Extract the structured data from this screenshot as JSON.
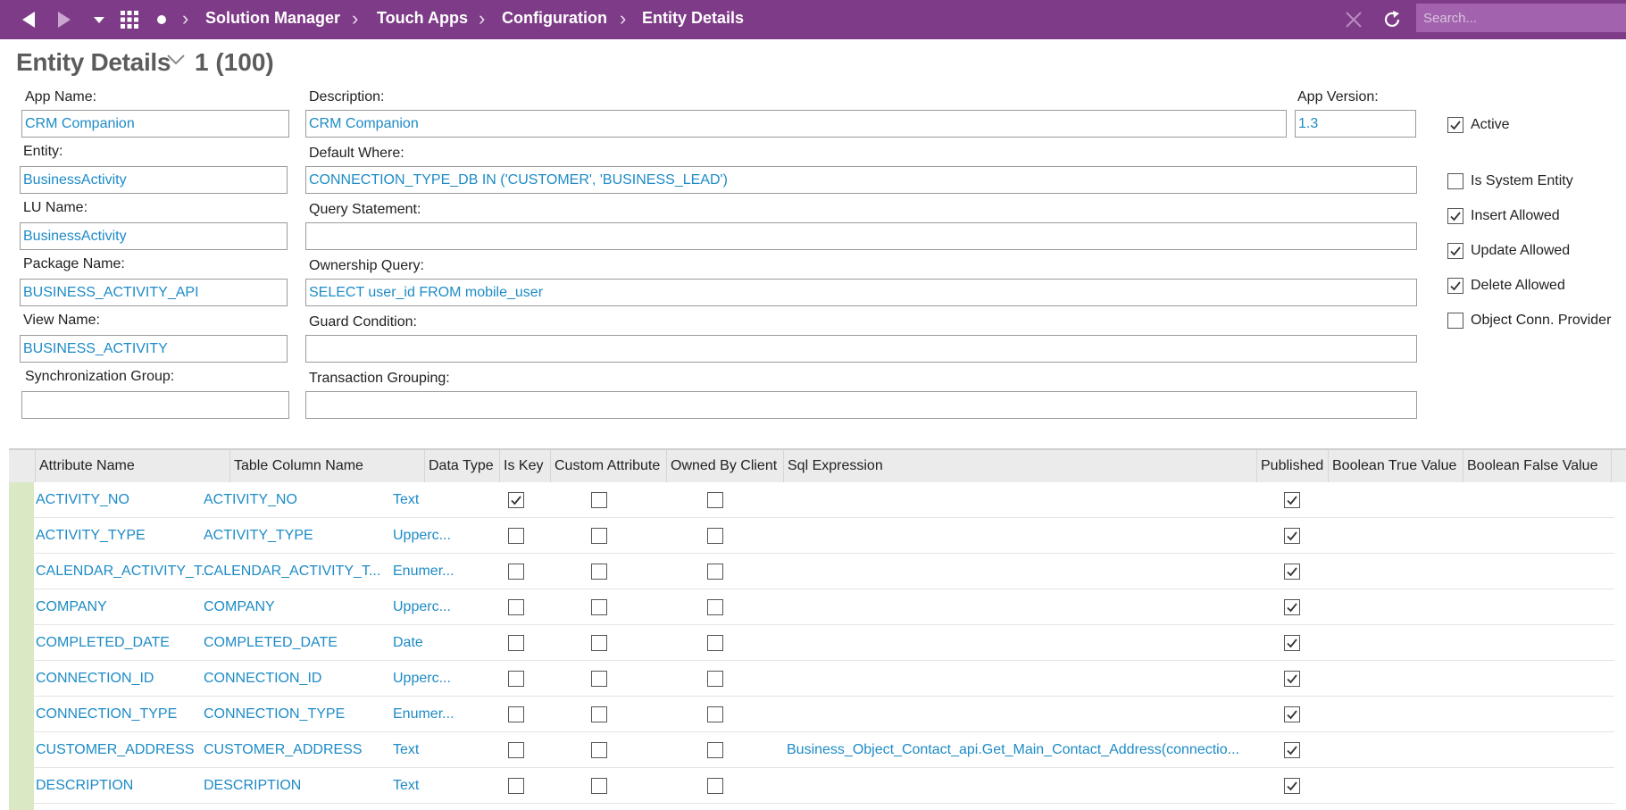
{
  "breadcrumb": [
    "Solution Manager",
    "Touch Apps",
    "Configuration",
    "Entity Details"
  ],
  "search": {
    "placeholder": "Search..."
  },
  "page": {
    "title": "Entity Details",
    "count": "1 (100)"
  },
  "form": {
    "app_name": {
      "label": "App Name:",
      "value": "CRM Companion"
    },
    "description": {
      "label": "Description:",
      "value": "CRM Companion"
    },
    "app_version": {
      "label": "App Version:",
      "value": "1.3"
    },
    "entity": {
      "label": "Entity:",
      "value": "BusinessActivity"
    },
    "default_where": {
      "label": "Default Where:",
      "value": "CONNECTION_TYPE_DB IN ('CUSTOMER', 'BUSINESS_LEAD')"
    },
    "lu_name": {
      "label": "LU Name:",
      "value": "BusinessActivity"
    },
    "query_statement": {
      "label": "Query Statement:",
      "value": ""
    },
    "package_name": {
      "label": "Package Name:",
      "value": "BUSINESS_ACTIVITY_API"
    },
    "ownership_query": {
      "label": "Ownership Query:",
      "value": "SELECT user_id FROM mobile_user"
    },
    "view_name": {
      "label": "View Name:",
      "value": "BUSINESS_ACTIVITY"
    },
    "guard_condition": {
      "label": "Guard Condition:",
      "value": ""
    },
    "sync_group": {
      "label": "Synchronization Group:",
      "value": ""
    },
    "transaction_grouping": {
      "label": "Transaction Grouping:",
      "value": ""
    }
  },
  "flags": {
    "active": {
      "label": "Active",
      "checked": true
    },
    "is_system_entity": {
      "label": "Is System Entity",
      "checked": false
    },
    "insert_allowed": {
      "label": "Insert Allowed",
      "checked": true
    },
    "update_allowed": {
      "label": "Update Allowed",
      "checked": true
    },
    "delete_allowed": {
      "label": "Delete Allowed",
      "checked": true
    },
    "object_conn_provider": {
      "label": "Object Conn. Provider",
      "checked": false
    }
  },
  "table": {
    "columns": [
      "Attribute Name",
      "Table Column Name",
      "Data Type",
      "Is Key",
      "Custom Attribute",
      "Owned By Client",
      "Sql Expression",
      "Published",
      "Boolean True Value",
      "Boolean False Value"
    ],
    "rows": [
      {
        "attr": "ACTIVITY_NO",
        "col": "ACTIVITY_NO",
        "type": "Text",
        "is_key": true,
        "custom": false,
        "owned": false,
        "sql": "",
        "published": true
      },
      {
        "attr": "ACTIVITY_TYPE",
        "col": "ACTIVITY_TYPE",
        "type": "Upperc...",
        "is_key": false,
        "custom": false,
        "owned": false,
        "sql": "",
        "published": true
      },
      {
        "attr": "CALENDAR_ACTIVITY_T...",
        "col": "CALENDAR_ACTIVITY_T...",
        "type": "Enumer...",
        "is_key": false,
        "custom": false,
        "owned": false,
        "sql": "",
        "published": true
      },
      {
        "attr": "COMPANY",
        "col": "COMPANY",
        "type": "Upperc...",
        "is_key": false,
        "custom": false,
        "owned": false,
        "sql": "",
        "published": true
      },
      {
        "attr": "COMPLETED_DATE",
        "col": "COMPLETED_DATE",
        "type": "Date",
        "is_key": false,
        "custom": false,
        "owned": false,
        "sql": "",
        "published": true
      },
      {
        "attr": "CONNECTION_ID",
        "col": "CONNECTION_ID",
        "type": "Upperc...",
        "is_key": false,
        "custom": false,
        "owned": false,
        "sql": "",
        "published": true
      },
      {
        "attr": "CONNECTION_TYPE",
        "col": "CONNECTION_TYPE",
        "type": "Enumer...",
        "is_key": false,
        "custom": false,
        "owned": false,
        "sql": "",
        "published": true
      },
      {
        "attr": "CUSTOMER_ADDRESS",
        "col": "CUSTOMER_ADDRESS",
        "type": "Text",
        "is_key": false,
        "custom": false,
        "owned": false,
        "sql": "Business_Object_Contact_api.Get_Main_Contact_Address(connectio...",
        "published": true
      },
      {
        "attr": "DESCRIPTION",
        "col": "DESCRIPTION",
        "type": "Text",
        "is_key": false,
        "custom": false,
        "owned": false,
        "sql": "",
        "published": true
      }
    ]
  },
  "colors": {
    "topbar": "#7e3b87",
    "link": "#1d8bc6",
    "row_marker": "#dbe8c4"
  }
}
